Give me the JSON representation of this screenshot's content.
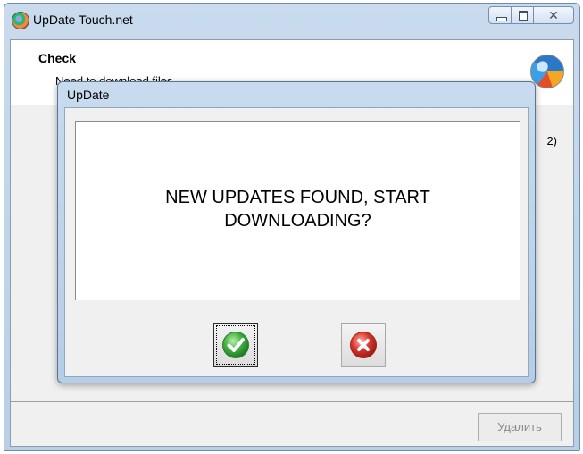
{
  "window": {
    "title": "UpDate Touch.net",
    "icon": "app-globe-icon",
    "caption_buttons": [
      "minimize-icon",
      "maximize-icon",
      "close-icon"
    ]
  },
  "header": {
    "title": "Check",
    "subtitle": "Need to download files",
    "logo_icon": "update-globe-icon"
  },
  "background": {
    "partial_text": "2)",
    "delete_button_label": "Удалить"
  },
  "dialog": {
    "title": "UpDate",
    "message_line1": "NEW UPDATES FOUND, START",
    "message_line2": "DOWNLOADING?",
    "ok_icon": "check-icon",
    "cancel_icon": "cancel-x-icon"
  },
  "colors": {
    "ok_green": "#3fae3f",
    "cancel_red": "#d9342b",
    "window_frame": "#b9cfe6"
  }
}
